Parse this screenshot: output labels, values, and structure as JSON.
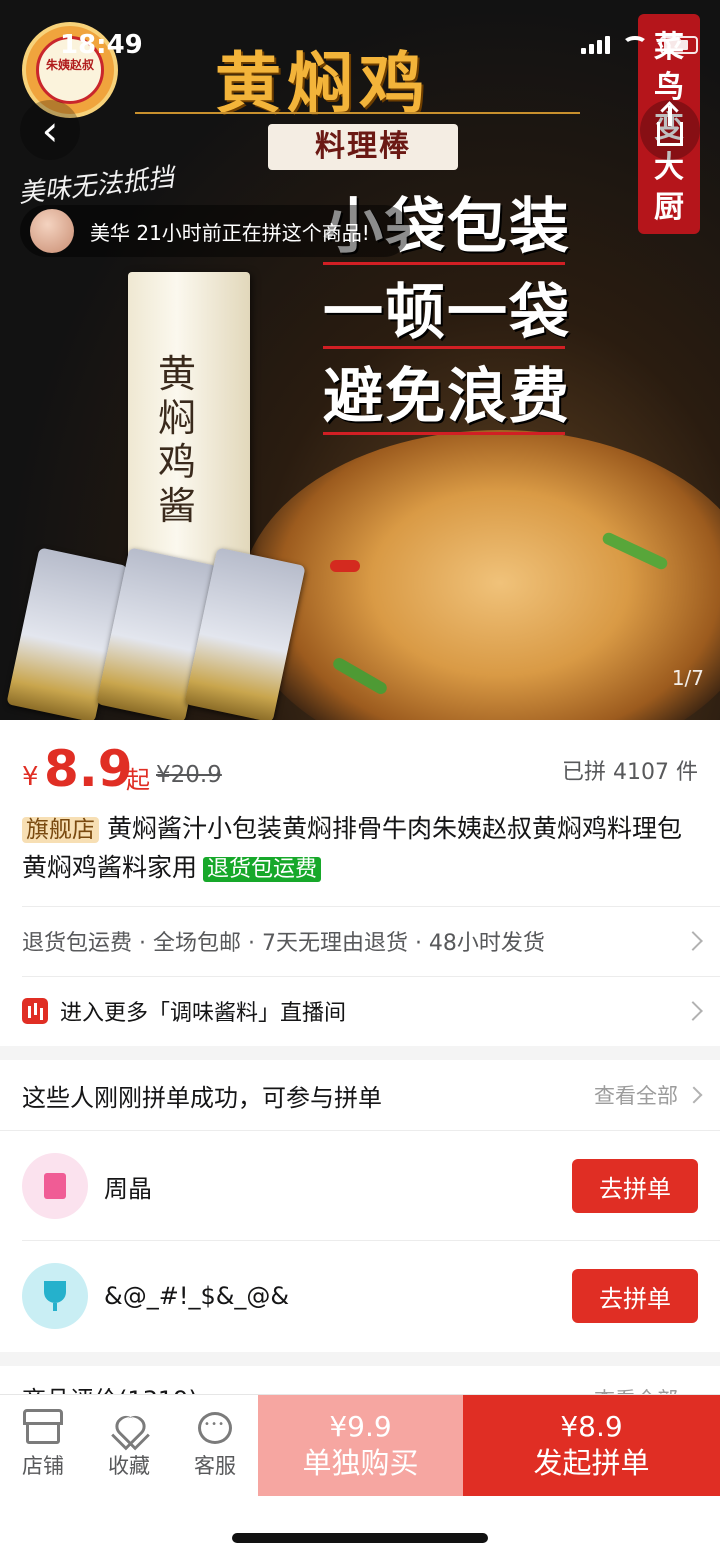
{
  "status_bar": {
    "time": "18:49"
  },
  "hero": {
    "brand_title": "黄焖鸡",
    "sub_title": "料理棒",
    "slogan": "美味无法抵挡",
    "logo_text": "朱姨赵叔",
    "side_banner": [
      "菜",
      "鸟",
      "变",
      "大",
      "厨"
    ],
    "promo_lines": [
      "小袋包装",
      "一顿一袋",
      "避免浪费"
    ],
    "package_text": "黄焖鸡酱",
    "pager": "1/7",
    "group_tip": "美华 21小时前正在拼这个商品!"
  },
  "product": {
    "currency": "¥",
    "price": "8.9",
    "price_suffix": "起",
    "original_price": "¥20.9",
    "sold": "已拼 4107 件",
    "shop_tag": "旗舰店",
    "title": "黄焖酱汁小包装黄焖排骨牛肉朱姨赵叔黄焖鸡料理包黄焖鸡酱料家用",
    "return_tag": "退货包运费"
  },
  "services": {
    "text": "退货包运费 · 全场包邮 · 7天无理由退货 · 48小时发货"
  },
  "live": {
    "text": "进入更多「调味酱料」直播间"
  },
  "group_buy": {
    "header": "这些人刚刚拼单成功，可参与拼单",
    "view_all": "查看全部",
    "users": [
      {
        "name": "周晶",
        "button": "去拼单"
      },
      {
        "name": "&@_#!_$&_@&",
        "button": "去拼单"
      }
    ]
  },
  "reviews": {
    "title": "商品评价(1319)",
    "view_all": "查看全部"
  },
  "bottom_bar": {
    "store": "店铺",
    "favorite": "收藏",
    "service": "客服",
    "buy_alone_price": "¥9.9",
    "buy_alone_label": "单独购买",
    "buy_group_price": "¥8.9",
    "buy_group_label": "发起拼单"
  },
  "colors": {
    "accent": "#e02e24",
    "accent_light": "#f6a6a1",
    "green_tag": "#17a82a"
  }
}
